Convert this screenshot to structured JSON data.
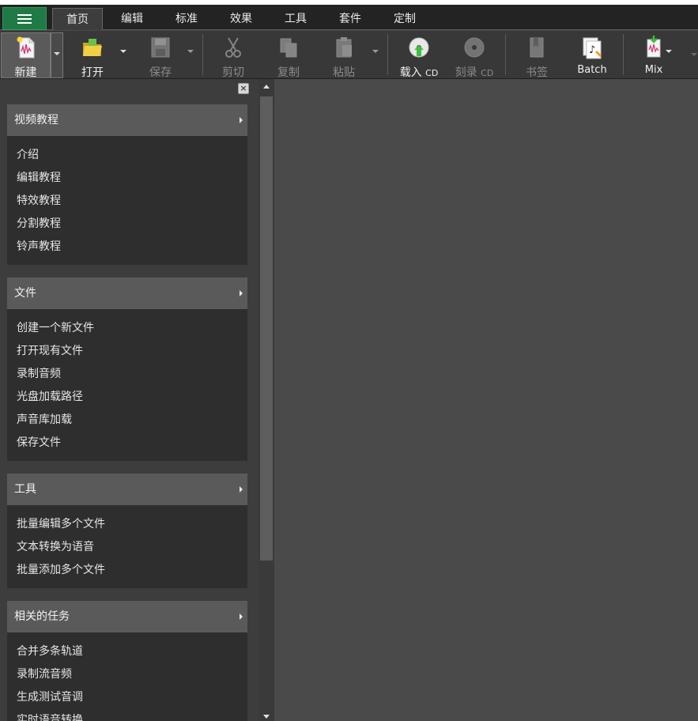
{
  "menu": {
    "icon": "hamburger-menu-icon"
  },
  "tabs": [
    {
      "label": "首页",
      "active": true
    },
    {
      "label": "编辑"
    },
    {
      "label": "标准"
    },
    {
      "label": "效果"
    },
    {
      "label": "工具"
    },
    {
      "label": "套件"
    },
    {
      "label": "定制"
    }
  ],
  "ribbon": {
    "new": {
      "label": "新建",
      "icon": "new-file-icon"
    },
    "open": {
      "label": "打开",
      "icon": "open-folder-icon"
    },
    "save": {
      "label": "保存",
      "icon": "save-disk-icon"
    },
    "cut": {
      "label": "剪切",
      "icon": "scissors-icon"
    },
    "copy": {
      "label": "复制",
      "icon": "copy-icon"
    },
    "paste": {
      "label": "粘贴",
      "icon": "paste-icon"
    },
    "load_cd": {
      "label": "载入",
      "sub": "CD",
      "icon": "load-cd-icon"
    },
    "burn_cd": {
      "label": "刻录",
      "sub": "CD",
      "icon": "burn-cd-icon"
    },
    "bookmark": {
      "label": "书签",
      "icon": "bookmark-icon"
    },
    "batch": {
      "label": "Batch",
      "icon": "batch-icon"
    },
    "mix": {
      "label": "Mix",
      "icon": "mix-icon"
    }
  },
  "panel": {
    "sections": [
      {
        "title": "视频教程",
        "items": [
          "介绍",
          "编辑教程",
          "特效教程",
          "分割教程",
          "铃声教程"
        ]
      },
      {
        "title": "文件",
        "items": [
          "创建一个新文件",
          "打开现有文件",
          "录制音频",
          "光盘加载路径",
          "声音库加载",
          "保存文件"
        ]
      },
      {
        "title": "工具",
        "items": [
          "批量编辑多个文件",
          "文本转换为语音",
          "批量添加多个文件"
        ]
      },
      {
        "title": "相关的任务",
        "items": [
          "合并多条轨道",
          "录制流音频",
          "生成测试音调",
          "实时语音转换"
        ]
      }
    ]
  },
  "colors": {
    "accent_green": "#1f7a45",
    "panel_header": "#5a5a5a",
    "panel_body": "#2e2e2e",
    "workspace": "#4a4a4a"
  }
}
